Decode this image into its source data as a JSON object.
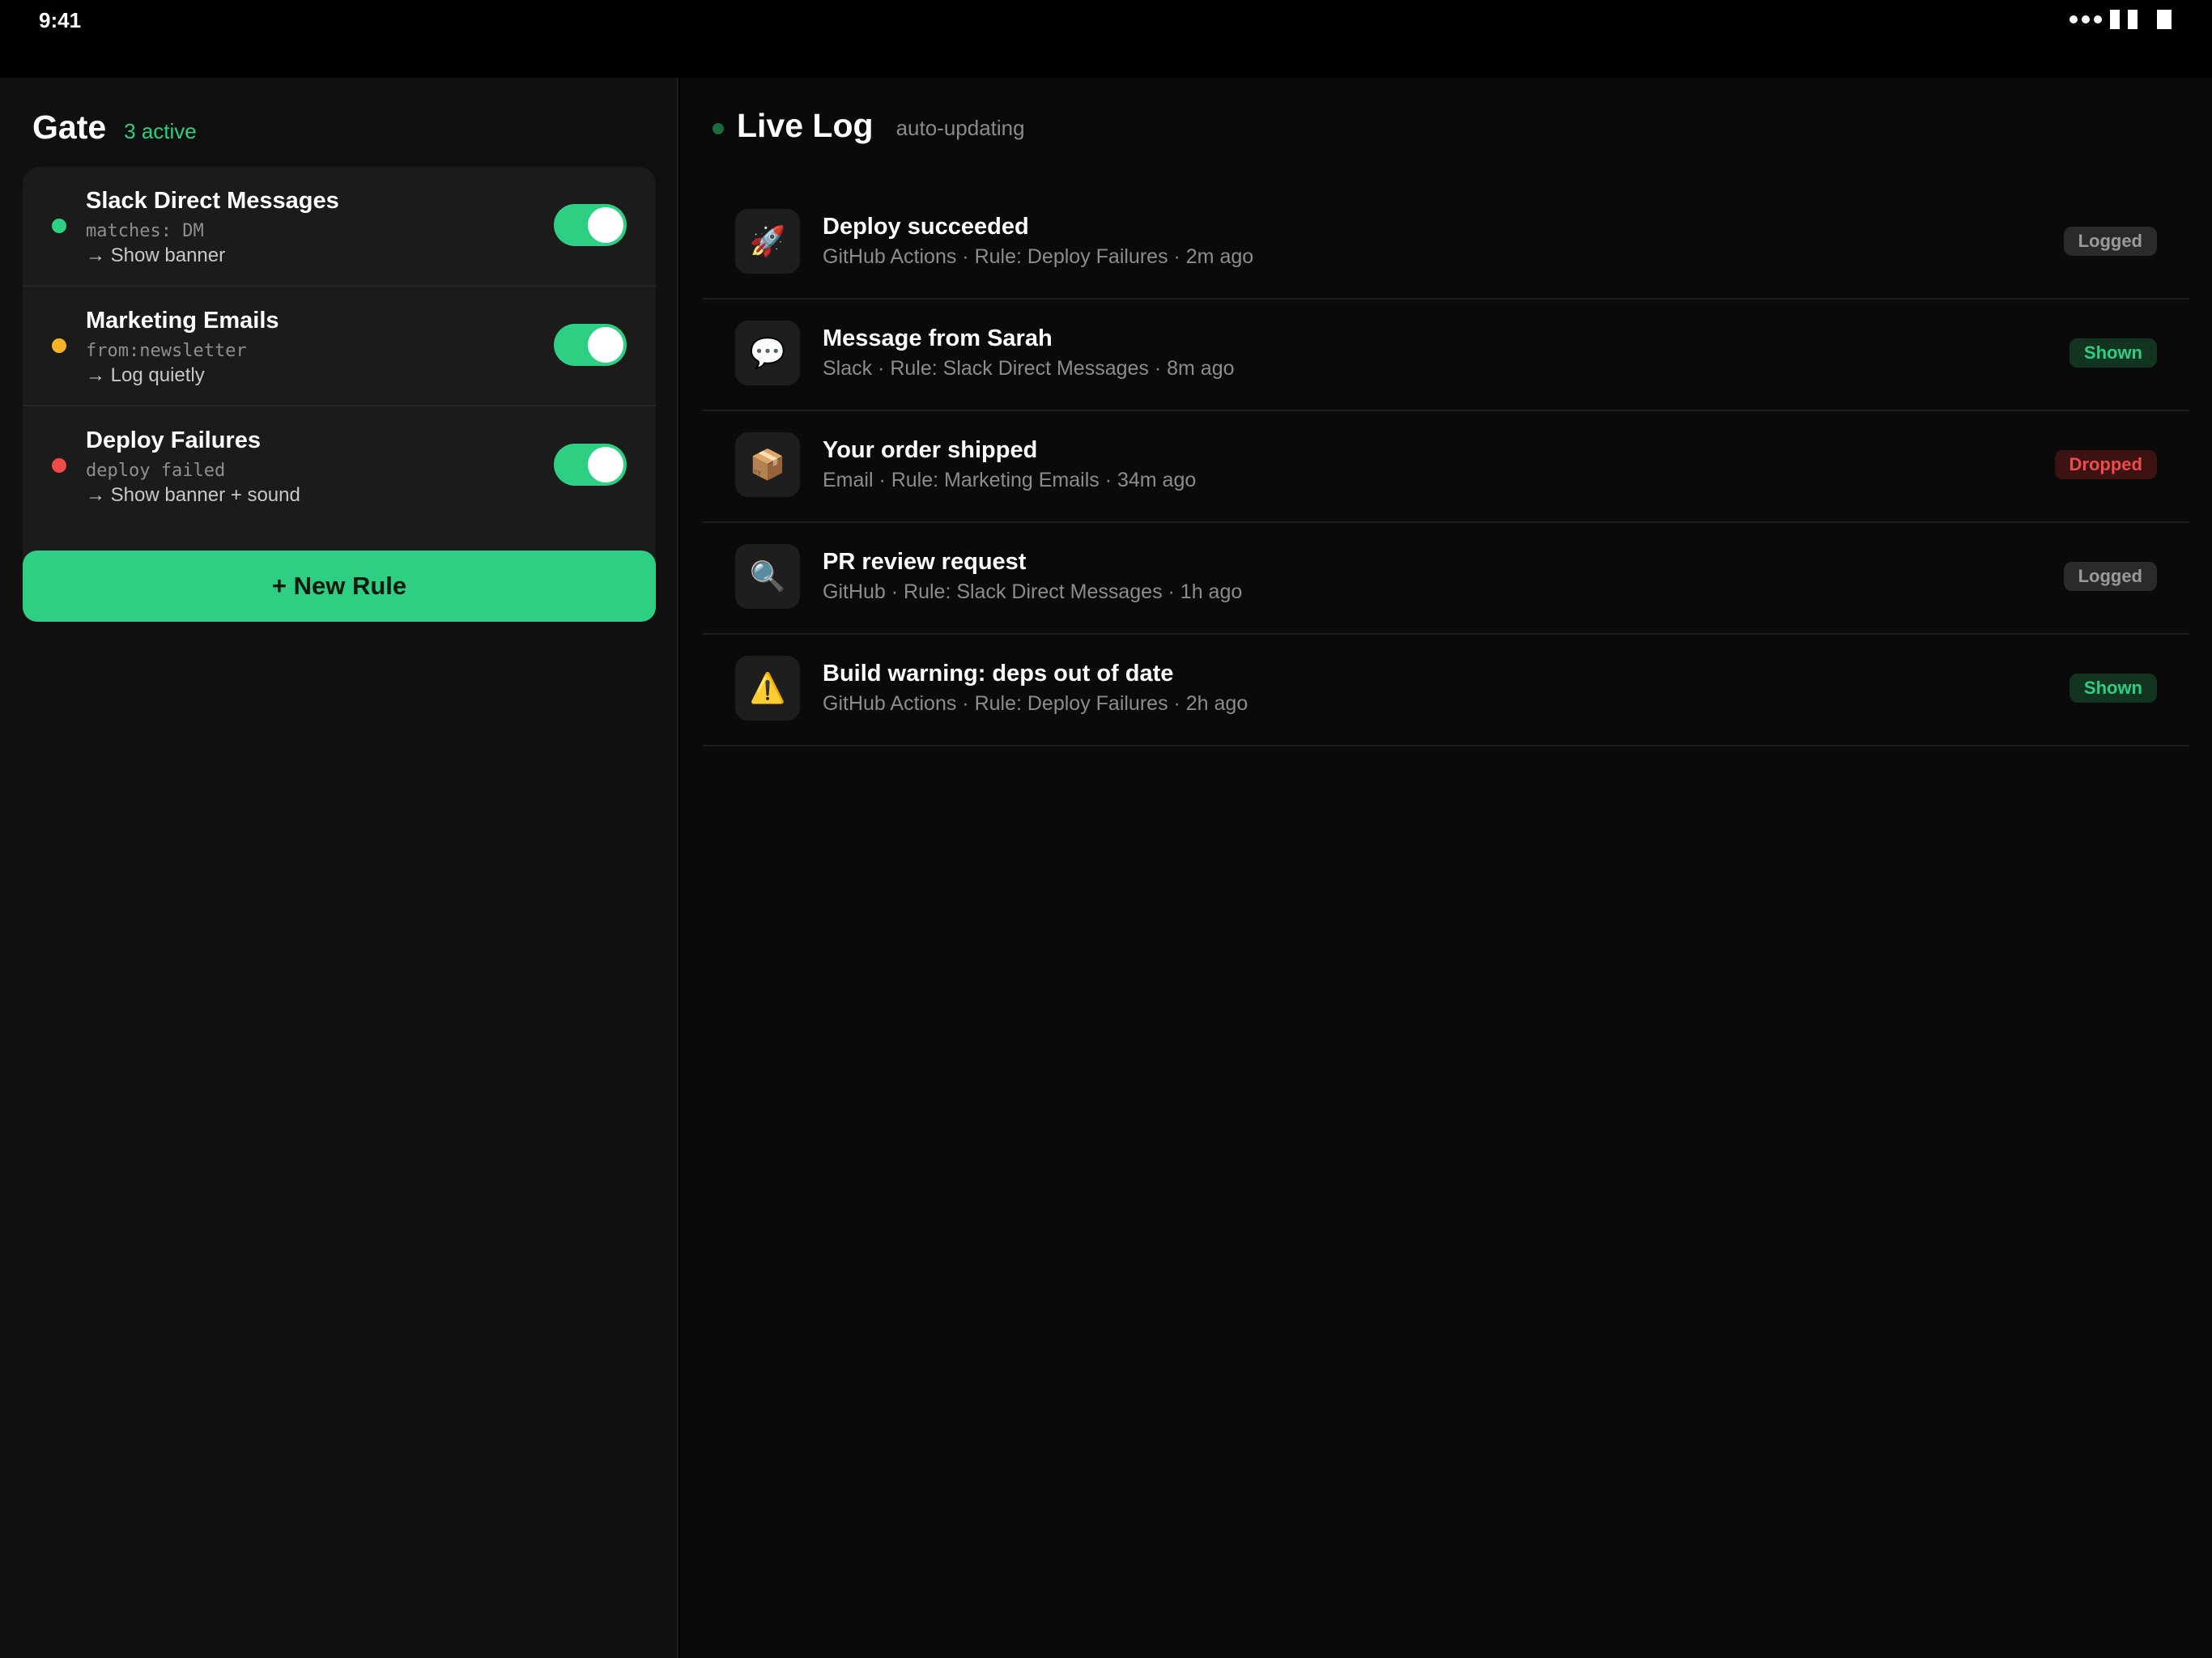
{
  "status_bar": {
    "time": "9:41"
  },
  "gate": {
    "title": "Gate",
    "count": "3 active",
    "rules": [
      {
        "name": "Slack Direct Messages",
        "match": "matches: DM",
        "action": "→ Show banner",
        "dot_color": "#2ecf82",
        "enabled": true
      },
      {
        "name": "Marketing Emails",
        "match": "from:newsletter",
        "action": "→ Log quietly",
        "dot_color": "#f5b428",
        "enabled": true
      },
      {
        "name": "Deploy Failures",
        "match": "deploy failed",
        "action": "→ Show banner + sound",
        "dot_color": "#ee4b4b",
        "enabled": true
      }
    ],
    "new_rule_label": "+ New Rule"
  },
  "log": {
    "title": "Live Log",
    "subtitle": "auto-updating",
    "entries": [
      {
        "icon": "🚀",
        "icon_name": "rocket-icon",
        "title": "Deploy succeeded",
        "meta": "GitHub Actions · Rule: Deploy Failures · 2m ago",
        "status": "Logged",
        "status_kind": "logged"
      },
      {
        "icon": "💬",
        "icon_name": "speech-bubble-icon",
        "title": "Message from Sarah",
        "meta": "Slack · Rule: Slack Direct Messages · 8m ago",
        "status": "Shown",
        "status_kind": "shown"
      },
      {
        "icon": "📦",
        "icon_name": "package-icon",
        "title": "Your order shipped",
        "meta": "Email · Rule: Marketing Emails · 34m ago",
        "status": "Dropped",
        "status_kind": "dropped"
      },
      {
        "icon": "🔍",
        "icon_name": "magnifier-icon",
        "title": "PR review request",
        "meta": "GitHub · Rule: Slack Direct Messages · 1h ago",
        "status": "Logged",
        "status_kind": "logged"
      },
      {
        "icon": "⚠️",
        "icon_name": "warning-icon",
        "title": "Build warning: deps out of date",
        "meta": "GitHub Actions · Rule: Deploy Failures · 2h ago",
        "status": "Shown",
        "status_kind": "shown"
      }
    ]
  },
  "colors": {
    "accent": "#2ecf82",
    "background": "#0a0a0a",
    "panel": "#101010",
    "card": "#1b1b1b"
  }
}
